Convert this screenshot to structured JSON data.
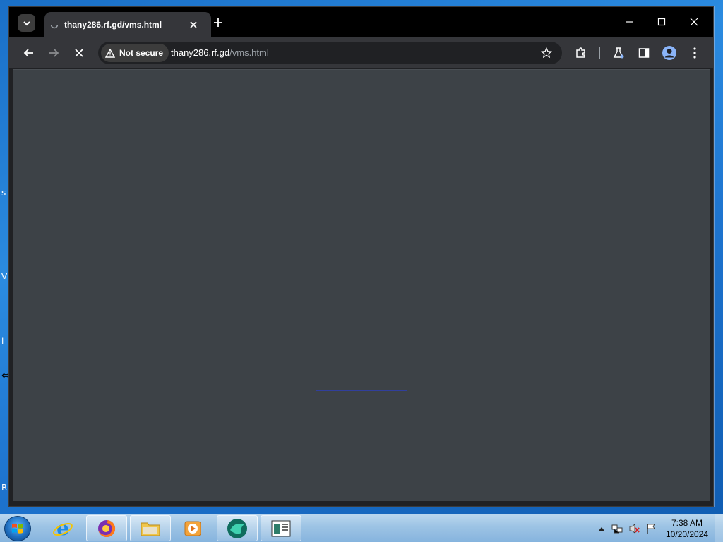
{
  "browser": {
    "tab": {
      "title": "thany286.rf.gd/vms.html"
    },
    "address": {
      "security_label": "Not secure",
      "url_host": "thany286.rf.gd",
      "url_path": "/vms.html"
    }
  },
  "desktop_glyphs": [
    "s",
    "V",
    "l",
    "R"
  ],
  "taskbar": {
    "apps": [
      "internet-explorer",
      "firefox",
      "file-explorer",
      "media-player",
      "app-teal",
      "app-window"
    ],
    "clock_time": "7:38 AM",
    "clock_date": "10/20/2024"
  },
  "colors": {
    "tab_bg": "#35363a",
    "tabstrip_bg": "#000000",
    "content_bg": "#3d4247",
    "desktop_blue": "#1e74cf"
  }
}
